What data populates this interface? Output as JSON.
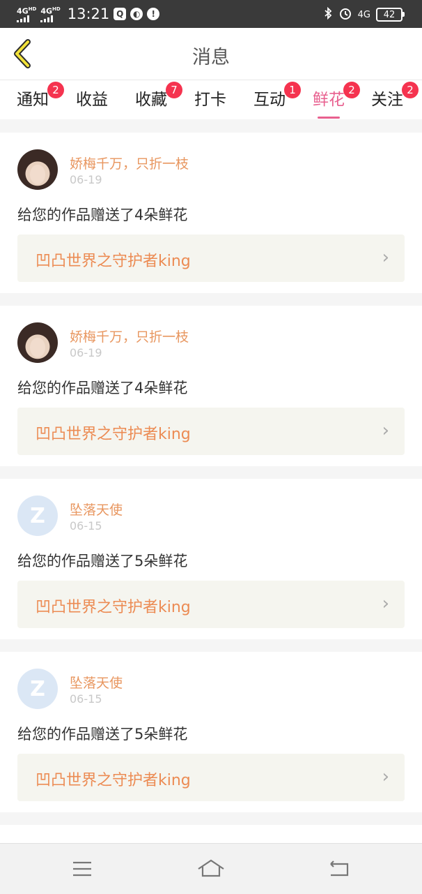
{
  "status_bar": {
    "signal1": "4G",
    "signal1_hd": "HD",
    "signal2": "4G",
    "signal2_hd": "HD",
    "time": "13:21",
    "net": "4G",
    "battery": "42",
    "left_icons": [
      "qq-icon",
      "browser-icon",
      "alert-icon"
    ],
    "right_icons": [
      "bluetooth-icon",
      "alarm-icon",
      "network-icon",
      "battery-icon"
    ]
  },
  "nav": {
    "title": "消息",
    "back_icon": "back-chevron-icon"
  },
  "tabs": [
    {
      "label": "通知",
      "badge": "2",
      "active": false
    },
    {
      "label": "收益",
      "badge": "",
      "active": false
    },
    {
      "label": "收藏",
      "badge": "7",
      "active": false
    },
    {
      "label": "打卡",
      "badge": "",
      "active": false
    },
    {
      "label": "互动",
      "badge": "1",
      "active": false
    },
    {
      "label": "鲜花",
      "badge": "2",
      "active": true
    },
    {
      "label": "关注",
      "badge": "2",
      "active": false
    }
  ],
  "messages": [
    {
      "user": "娇梅千万，只折一枝",
      "date": "06-19",
      "text": "给您的作品赠送了4朵鲜花",
      "work": "凹凸世界之守护者king",
      "avatar": "photo-avatar"
    },
    {
      "user": "娇梅千万，只折一枝",
      "date": "06-19",
      "text": "给您的作品赠送了4朵鲜花",
      "work": "凹凸世界之守护者king",
      "avatar": "photo-avatar"
    },
    {
      "user": "坠落天使",
      "date": "06-15",
      "text": "给您的作品赠送了5朵鲜花",
      "work": "凹凸世界之守护者king",
      "avatar": "default-avatar"
    },
    {
      "user": "坠落天使",
      "date": "06-15",
      "text": "给您的作品赠送了5朵鲜花",
      "work": "凹凸世界之守护者king",
      "avatar": "default-avatar"
    }
  ],
  "bottom_nav": [
    "menu-icon",
    "home-icon",
    "back-icon"
  ],
  "colors": {
    "active_tab": "#e8608f",
    "badge": "#f5334f",
    "username": "#e8965f",
    "work_title": "#ec8b53",
    "statusbar": "#3a3a3a"
  }
}
